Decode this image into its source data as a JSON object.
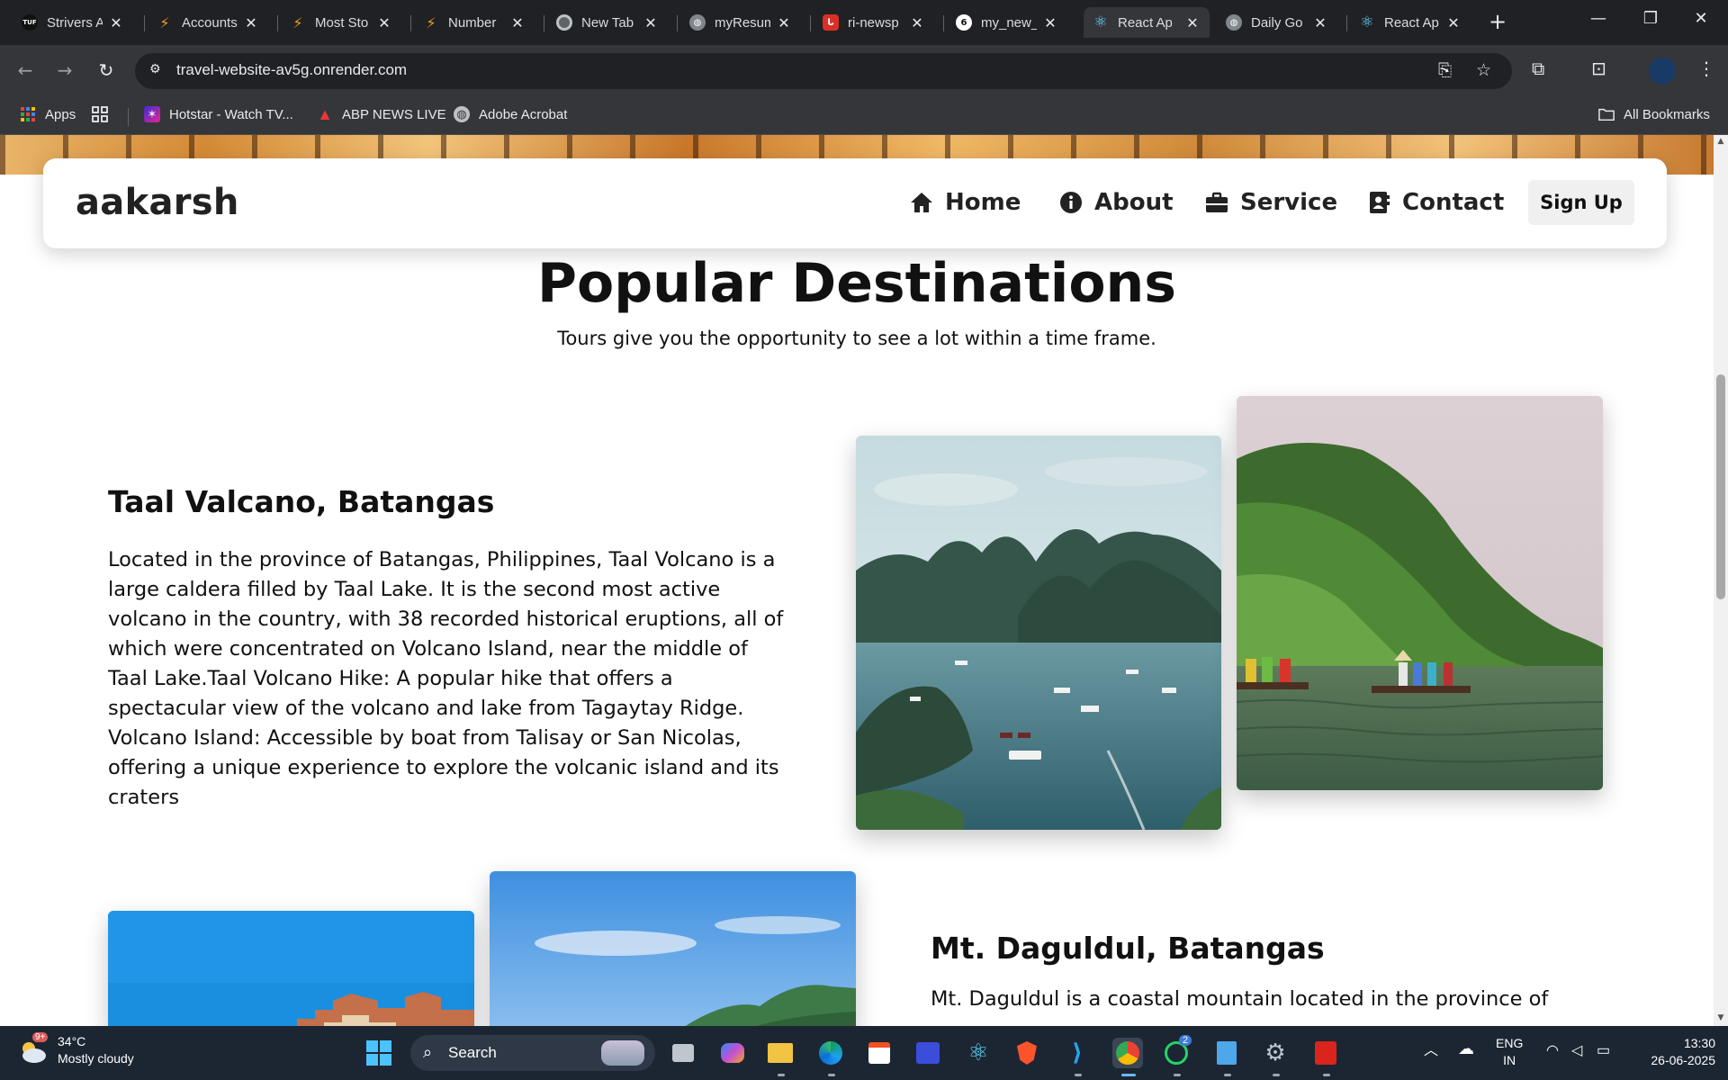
{
  "browser": {
    "tabs": [
      {
        "title": "Strivers A",
        "favicon": "tuf-icon",
        "color": "#111111"
      },
      {
        "title": "Accounts",
        "favicon": "orange-bolt-icon",
        "color": "#f0a020"
      },
      {
        "title": "Most Sto",
        "favicon": "orange-bolt-icon",
        "color": "#f0a020"
      },
      {
        "title": "Number",
        "favicon": "orange-bolt-icon",
        "color": "#f0a020"
      },
      {
        "title": "New Tab",
        "favicon": "chrome-icon",
        "color": "#5f6368"
      },
      {
        "title": "myResum",
        "favicon": "globe-icon",
        "color": "#5f6368"
      },
      {
        "title": "ri-newsp",
        "favicon": "red-logo-icon",
        "color": "#d93025"
      },
      {
        "title": "my_new_",
        "favicon": "renderer-icon",
        "color": "#ffffff"
      },
      {
        "title": "React Ap",
        "favicon": "react-icon",
        "color": "#61dafb",
        "active": true
      },
      {
        "title": "Daily Go",
        "favicon": "globe-icon",
        "color": "#5f6368"
      },
      {
        "title": "React Ap",
        "favicon": "react-icon",
        "color": "#61dafb"
      }
    ],
    "url": "travel-website-av5g.onrender.com",
    "bookmarks": [
      {
        "label": "Apps",
        "icon": "apps-grid-icon"
      },
      {
        "label": "",
        "icon": "tab-groups-icon"
      },
      {
        "label": "Hotstar - Watch TV...",
        "icon": "hotstar-icon"
      },
      {
        "label": "ABP NEWS LIVE",
        "icon": "abp-icon"
      },
      {
        "label": "Adobe Acrobat",
        "icon": "globe-icon"
      }
    ],
    "all_bookmarks": "All Bookmarks"
  },
  "site": {
    "logo": "aakarsh",
    "nav": [
      {
        "label": "Home",
        "icon": "home-icon"
      },
      {
        "label": "About",
        "icon": "info-icon"
      },
      {
        "label": "Service",
        "icon": "briefcase-icon"
      },
      {
        "label": "Contact",
        "icon": "contact-book-icon"
      }
    ],
    "signup": "Sign Up",
    "section_title": "Popular Destinations",
    "section_subtitle": "Tours give you the opportunity to see a lot within a time frame.",
    "destinations": [
      {
        "title": "Taal Valcano, Batangas",
        "text": "Located in the province of Batangas, Philippines, Taal Volcano is a large caldera filled by Taal Lake. It is the second most active volcano in the country, with 38 recorded historical eruptions, all of which were concentrated on Volcano Island, near the middle of Taal Lake.Taal Volcano Hike: A popular hike that offers a spectacular view of the volcano and lake from Tagaytay Ridge. Volcano Island: Accessible by boat from Talisay or San Nicolas, offering a unique experience to explore the volcanic island and its craters"
      },
      {
        "title": "Mt. Daguldul, Batangas",
        "text": "Mt. Daguldul is a coastal mountain located in the province of"
      }
    ]
  },
  "taskbar": {
    "weather_temp": "34°C",
    "weather_desc": "Mostly cloudy",
    "weather_badge": "9+",
    "search": "Search",
    "whatsapp_badge": "2",
    "lang_top": "ENG",
    "lang_bottom": "IN",
    "time": "13:30",
    "date": "26-06-2025"
  },
  "colors": {
    "chrome_dark": "#202124",
    "chrome_toolbar": "#35363a",
    "taskbar": "#1c2633",
    "signup_bg": "#f0f0f0"
  }
}
